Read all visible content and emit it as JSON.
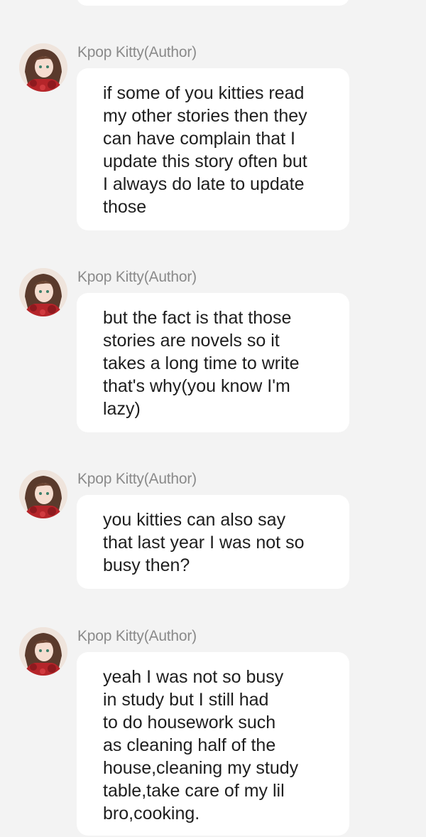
{
  "messages": [
    {
      "author": "Kpop Kitty(Author)",
      "avatar_icon": "anime-girl-avatar-icon",
      "text": "if some of you kitties read\nmy other stories then they\ncan have complain that I\nupdate this story often but\nI always do late to update\nthose"
    },
    {
      "author": "Kpop Kitty(Author)",
      "avatar_icon": "anime-girl-avatar-icon",
      "text": "but the fact is that those\nstories are novels so it\ntakes a long time to write\nthat's why(you know I'm\nlazy)"
    },
    {
      "author": "Kpop Kitty(Author)",
      "avatar_icon": "anime-girl-avatar-icon",
      "text": "you kitties can also say\nthat last year I was not so\nbusy then?"
    },
    {
      "author": "Kpop Kitty(Author)",
      "avatar_icon": "anime-girl-avatar-icon",
      "text": "yeah I was not so busy\nin study but I still had\nto do housework such\nas cleaning half of the\nhouse,cleaning my study\ntable,take care of my lil\nbro,cooking."
    }
  ],
  "colors": {
    "background": "#f3f3f3",
    "bubble": "#ffffff",
    "author_text": "#8a8a8a",
    "message_text": "#1e1e1e"
  }
}
